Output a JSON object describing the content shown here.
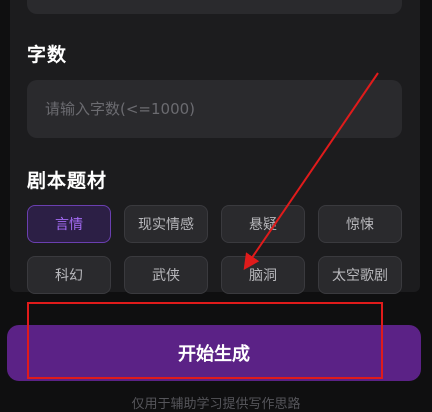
{
  "wordcount": {
    "title": "字数",
    "placeholder": "请输入字数(<=1000)"
  },
  "genre": {
    "title": "剧本题材",
    "selected": "言情",
    "options": [
      "言情",
      "现实情感",
      "悬疑",
      "惊悚",
      "科幻",
      "武侠",
      "脑洞",
      "太空歌剧"
    ]
  },
  "generate_button": "开始生成",
  "footnote": "仅用于辅助学习提供写作思路",
  "colors": {
    "accent": "#5b2286",
    "selected_text": "#a46bf5",
    "annotation": "#e01b1b"
  }
}
